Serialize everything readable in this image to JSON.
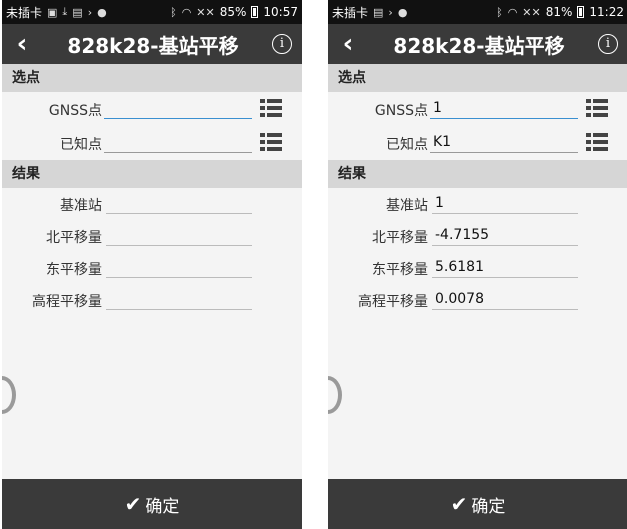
{
  "screens": [
    {
      "status": {
        "carrier": "未插卡",
        "battery": "85%",
        "time": "10:57"
      },
      "title": "828k28-基站平移",
      "info_glyph": "i",
      "sections": {
        "select": "选点",
        "result": "结果"
      },
      "select_fields": [
        {
          "label": "GNSS点",
          "value": ""
        },
        {
          "label": "已知点",
          "value": ""
        }
      ],
      "result_fields": [
        {
          "label": "基准站",
          "value": ""
        },
        {
          "label": "北平移量",
          "value": ""
        },
        {
          "label": "东平移量",
          "value": ""
        },
        {
          "label": "高程平移量",
          "value": ""
        }
      ],
      "confirm_label": "确定"
    },
    {
      "status": {
        "carrier": "未插卡",
        "battery": "81%",
        "time": "11:22"
      },
      "title": "828k28-基站平移",
      "info_glyph": "i",
      "sections": {
        "select": "选点",
        "result": "结果"
      },
      "select_fields": [
        {
          "label": "GNSS点",
          "value": "1"
        },
        {
          "label": "已知点",
          "value": "K1"
        }
      ],
      "result_fields": [
        {
          "label": "基准站",
          "value": "1"
        },
        {
          "label": "北平移量",
          "value": "-4.7155"
        },
        {
          "label": "东平移量",
          "value": "5.6181"
        },
        {
          "label": "高程平移量",
          "value": "0.0078"
        }
      ],
      "confirm_label": "确定"
    }
  ],
  "icons": {
    "back": "chevron-left-icon",
    "info": "info-icon",
    "list": "list-icon",
    "confirm": "check-icon"
  },
  "colors": {
    "titlebar": "#3a3a3a",
    "section": "#d6d6d6",
    "active_underline": "#3a8fd0"
  }
}
